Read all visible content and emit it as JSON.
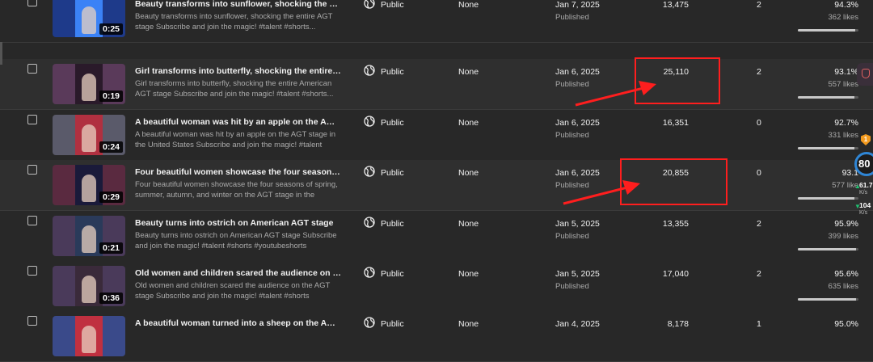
{
  "videos": [
    {
      "title": "Beauty transforms into sunflower, shocking the entire AG...",
      "description": "Beauty transforms into sunflower, shocking the entire AGT stage Subscribe and join the magic! #talent #shorts...",
      "duration": "0:25",
      "visibility": "Public",
      "restrictions": "None",
      "date": "Jan 7, 2025",
      "status": "Published",
      "views": "13,475",
      "comments": "2",
      "likes_pct": "94.3%",
      "likes_count": "362 likes",
      "likes_ratio": 0.943,
      "thumb_colors": [
        "#1e3a8a",
        "#3b82f6"
      ]
    },
    {
      "title": "Girl transforms into butterfly, shocking the entire American...",
      "description": "Girl transforms into butterfly, shocking the entire American AGT stage Subscribe and join the magic! #talent #shorts...",
      "duration": "0:19",
      "visibility": "Public",
      "restrictions": "None",
      "date": "Jan 6, 2025",
      "status": "Published",
      "views": "25,110",
      "comments": "2",
      "likes_pct": "93.1%",
      "likes_count": "557 likes",
      "likes_ratio": 0.931,
      "thumb_colors": [
        "#5a3a5a",
        "#2a1a2a"
      ]
    },
    {
      "title": "A beautiful woman was hit by an apple on the AGT stage i...",
      "description": "A beautiful woman was hit by an apple on the AGT stage in the United States Subscribe and join the magic! #talent #shorts...",
      "duration": "0:24",
      "visibility": "Public",
      "restrictions": "None",
      "date": "Jan 6, 2025",
      "status": "Published",
      "views": "16,351",
      "comments": "0",
      "likes_pct": "92.7%",
      "likes_count": "331 likes",
      "likes_ratio": 0.927,
      "thumb_colors": [
        "#5a5a6a",
        "#b03040"
      ]
    },
    {
      "title": "Four beautiful women showcase the four seasons of spri...",
      "description": "Four beautiful women showcase the four seasons of spring, summer, autumn, and winter on the AGT stage in the United...",
      "duration": "0:29",
      "visibility": "Public",
      "restrictions": "None",
      "date": "Jan 6, 2025",
      "status": "Published",
      "views": "20,855",
      "comments": "0",
      "likes_pct": "93.1",
      "likes_count": "577 like",
      "likes_ratio": 0.931,
      "thumb_colors": [
        "#5a2a40",
        "#1a1a3a"
      ]
    },
    {
      "title": "Beauty turns into ostrich on American AGT stage",
      "description": "Beauty turns into ostrich on American AGT stage  Subscribe and join the magic! #talent #shorts #youtubeshorts #memes...",
      "duration": "0:21",
      "visibility": "Public",
      "restrictions": "None",
      "date": "Jan 5, 2025",
      "status": "Published",
      "views": "13,355",
      "comments": "2",
      "likes_pct": "95.9%",
      "likes_count": "399 likes",
      "likes_ratio": 0.959,
      "thumb_colors": [
        "#4a3a5a",
        "#2a3a5a"
      ]
    },
    {
      "title": "Old women and children scared the audience on the AGT ...",
      "description": "Old women and children scared the audience on the AGT stage  Subscribe and join the magic! #talent #shorts #youtubeshort...",
      "duration": "0:36",
      "visibility": "Public",
      "restrictions": "None",
      "date": "Jan 5, 2025",
      "status": "Published",
      "views": "17,040",
      "comments": "2",
      "likes_pct": "95.6%",
      "likes_count": "635 likes",
      "likes_ratio": 0.956,
      "thumb_colors": [
        "#4a3a5a",
        "#3a2a3a"
      ]
    },
    {
      "title": "A beautiful woman turned into a sheep on the American A...",
      "description": "",
      "duration": "",
      "visibility": "Public",
      "restrictions": "None",
      "date": "Jan 4, 2025",
      "status": "",
      "views": "8,178",
      "comments": "1",
      "likes_pct": "95.0%",
      "likes_count": "",
      "likes_ratio": 0.95,
      "thumb_colors": [
        "#3a4a8a",
        "#c03040"
      ]
    }
  ],
  "widget": {
    "badge": "1",
    "gauge": "80",
    "upload": "61.7",
    "upload_unit": "K/s",
    "download": "104",
    "download_unit": "K/s"
  },
  "colors": {
    "highlight": "#ff1e1e",
    "accent": "#2f86d6"
  }
}
